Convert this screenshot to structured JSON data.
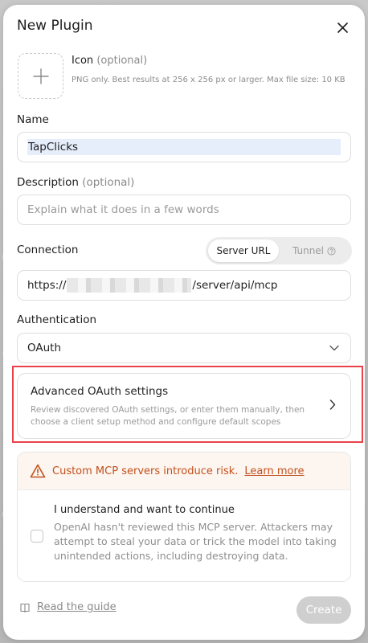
{
  "dialog": {
    "title": "New Plugin"
  },
  "icon_field": {
    "label": "Icon",
    "optional": "(optional)",
    "help": "PNG only. Best results at 256 x 256 px or larger. Max file size: 10 KB"
  },
  "name_field": {
    "label": "Name",
    "value": "TapClicks"
  },
  "description_field": {
    "label": "Description",
    "optional": "(optional)",
    "placeholder": "Explain what it does in a few words"
  },
  "connection": {
    "label": "Connection",
    "options": [
      "Server URL",
      "Tunnel"
    ],
    "selected": "Server URL",
    "url_prefix": "https://",
    "url_suffix": "/server/api/mcp"
  },
  "authentication": {
    "label": "Authentication",
    "selected": "OAuth"
  },
  "advanced_oauth": {
    "title": "Advanced OAuth settings",
    "description": "Review discovered OAuth settings, or enter them manually, then choose a client setup method and configure default scopes"
  },
  "risk": {
    "warning": "Custom MCP servers introduce risk.",
    "link": "Learn more",
    "consent_title": "I understand and want to continue",
    "consent_description": "OpenAI hasn't reviewed this MCP server. Attackers may attempt to steal your data or trick the model into taking unintended actions, including destroying data.",
    "checked": false
  },
  "footer": {
    "guide_link": "Read the guide",
    "create_label": "Create"
  },
  "colors": {
    "warning_text": "#c2501c",
    "warning_bg": "#fdf5ef",
    "highlight_border": "#e8434a",
    "disabled_button": "#cfcfcf"
  }
}
